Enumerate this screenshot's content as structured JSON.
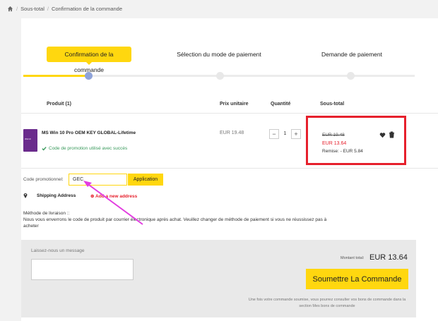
{
  "breadcrumb": {
    "home_icon": "home-icon",
    "items": [
      "Sous-total",
      "Confirmation de la commande"
    ]
  },
  "steps": [
    {
      "label": "Confirmation de la commande",
      "active": true
    },
    {
      "label": "Sélection du mode de paiement",
      "active": false
    },
    {
      "label": "Demande de paiement",
      "active": false
    }
  ],
  "colors": {
    "accent": "#ffd70f",
    "dot_active": "#8fa3d9",
    "dot_inactive": "#e8e8e8",
    "danger": "#e6202c",
    "success": "#3a9a5c"
  },
  "table": {
    "headers": {
      "product": "Produit (1)",
      "unit_price": "Prix unitaire",
      "quantity": "Quantité",
      "subtotal": "Sous-total"
    },
    "row": {
      "image_text": "Win10",
      "name": "MS Win 10 Pro OEM KEY GLOBAL-Lifetime",
      "promo_status": "Code de promotion utilisé avec succès",
      "unit_price": "EUR 19.48",
      "quantity": "1",
      "minus": "−",
      "plus": "+",
      "old_price": "EUR 19.48",
      "new_price": "EUR 13.64",
      "discount": "Remise: - EUR 5.84"
    }
  },
  "promo": {
    "label": "Code promotionnel:",
    "value": "GEC",
    "apply": "Application"
  },
  "shipping": {
    "label": "Shipping Address",
    "add": "Add a new address"
  },
  "delivery": {
    "title": "Méthode de livraison ::",
    "text": "Nous vous enverrons le code de produit par courrier électronique après achat. Veuillez changer de méthode de paiement si vous ne réussissez pas à acheter"
  },
  "message": {
    "label": "Laissez-nous un message",
    "placeholder": ""
  },
  "total": {
    "label": "Montant total:",
    "value": "EUR 13.64"
  },
  "submit": {
    "label": "Soumettre La Commande"
  },
  "note": "Une fois votre commande soumise, vous pourrez consulter vos bons de commande dans la section Mes bons de commande"
}
